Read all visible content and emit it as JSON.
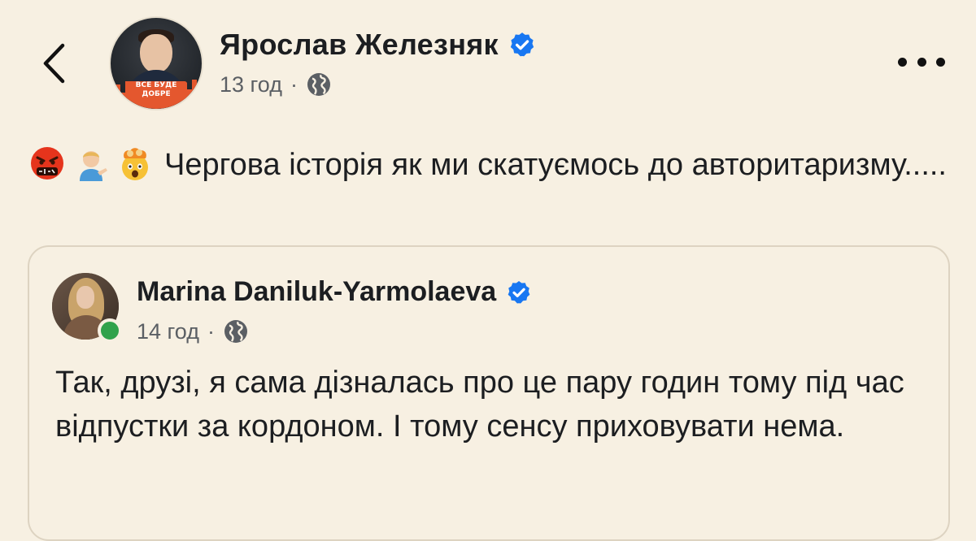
{
  "header": {
    "author_name": "Ярослав Железняк",
    "time": "13 год",
    "separator": "·",
    "avatar_badge_line1": "ВСЕ БУДЕ",
    "avatar_badge_line2": "ДОБРЕ"
  },
  "post": {
    "emojis": [
      "face-with-symbols-on-mouth",
      "person-tipping-hand",
      "exploding-head"
    ],
    "text": "Чергова історія як ми скатуємось до авторитаризму....."
  },
  "shared_post": {
    "author_name": "Marina Daniluk-Yarmolaeva",
    "time": "14 год",
    "separator": "·",
    "text": "Так, друзі, я сама дізналась про це пару годин тому під час відпустки за кордоном. І тому сенсу приховувати нема."
  },
  "colors": {
    "background": "#f7f0e2",
    "verified_blue": "#1877f2",
    "online_green": "#31a24c",
    "meta_gray": "#5b5f64"
  }
}
